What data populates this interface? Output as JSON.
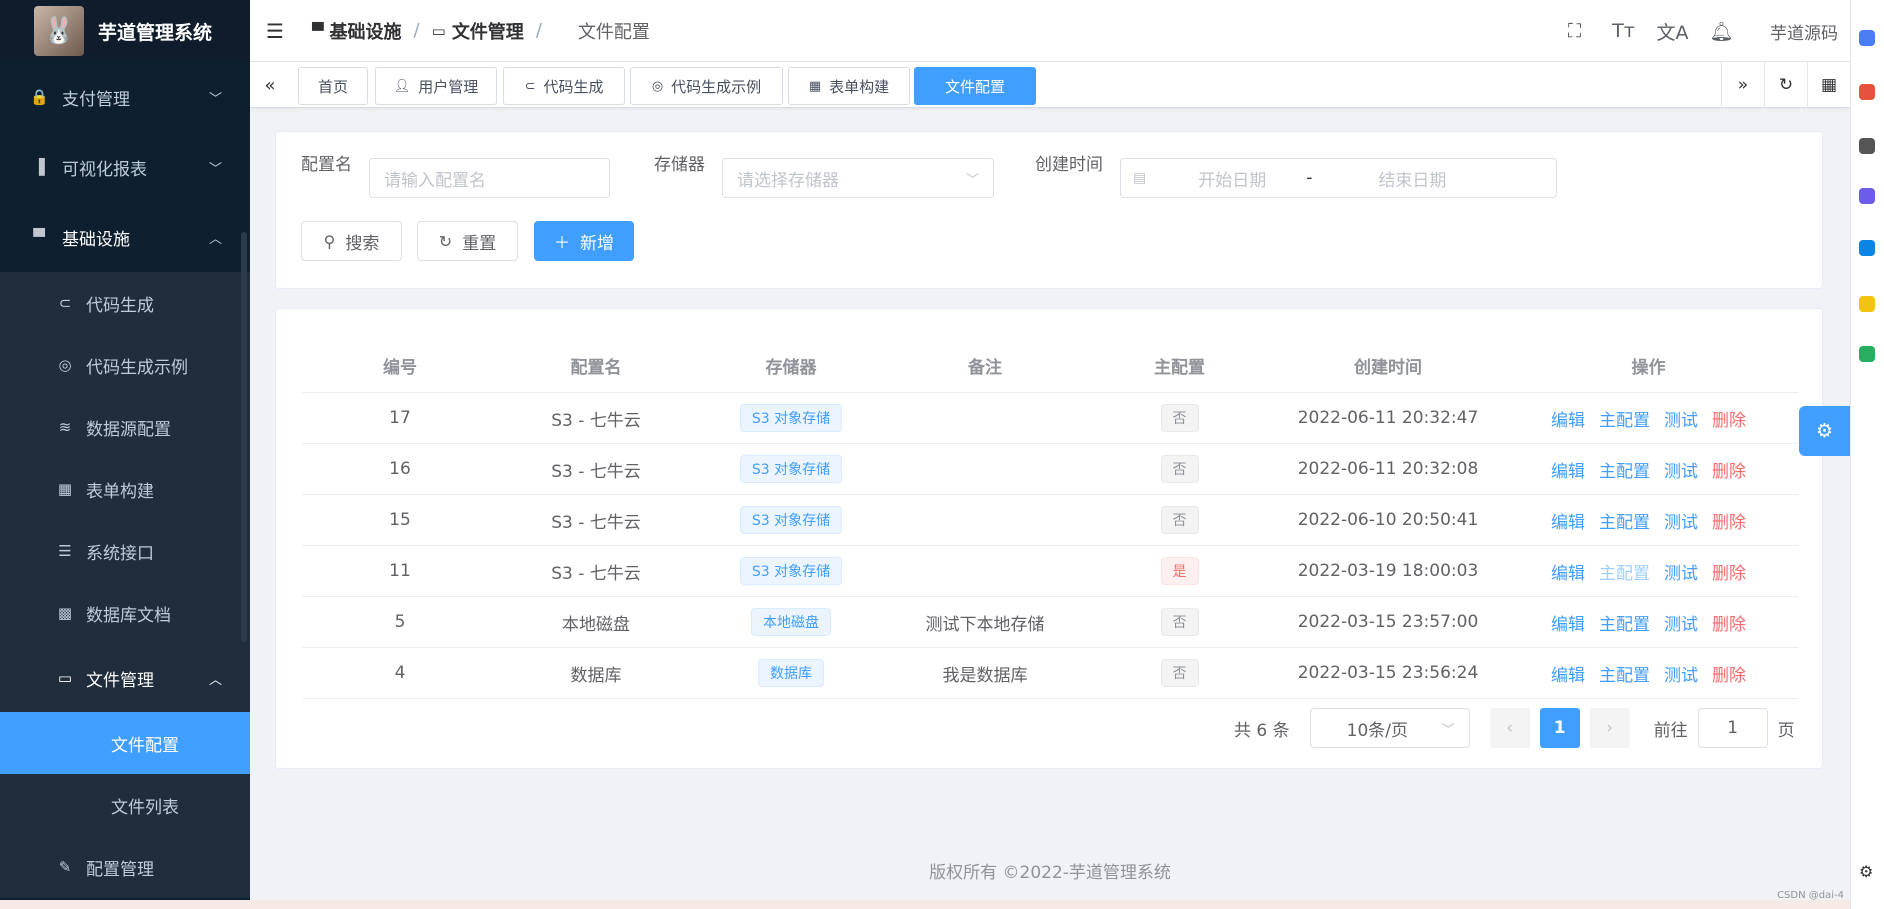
{
  "sidebar": {
    "title": "芋道管理系统",
    "items": [
      {
        "label": "支付管理",
        "icon": "lock-bag-icon"
      },
      {
        "label": "可视化报表",
        "icon": "bar-chart-icon"
      },
      {
        "label": "基础设施",
        "icon": "monitor-icon"
      }
    ],
    "infra_children": [
      {
        "label": "代码生成",
        "icon": "code-icon"
      },
      {
        "label": "代码生成示例",
        "icon": "compass-icon"
      },
      {
        "label": "数据源配置",
        "icon": "database-icon"
      },
      {
        "label": "表单构建",
        "icon": "form-icon"
      },
      {
        "label": "系统接口",
        "icon": "sliders-icon"
      },
      {
        "label": "数据库文档",
        "icon": "table-icon"
      },
      {
        "label": "文件管理",
        "icon": "folder-icon"
      }
    ],
    "file_children": [
      {
        "label": "文件配置"
      },
      {
        "label": "文件列表"
      }
    ],
    "last_item": {
      "label": "配置管理",
      "icon": "edit-icon"
    }
  },
  "navbar": {
    "breadcrumb": [
      "基础设施",
      "文件管理",
      "文件配置"
    ],
    "user": "芋道源码"
  },
  "tags": [
    "首页",
    "用户管理",
    "代码生成",
    "代码生成示例",
    "表单构建",
    "文件配置"
  ],
  "search": {
    "name_label": "配置名",
    "name_placeholder": "请输入配置名",
    "storage_label": "存储器",
    "storage_placeholder": "请选择存储器",
    "time_label": "创建时间",
    "start_placeholder": "开始日期",
    "range_sep": "-",
    "end_placeholder": "结束日期",
    "search_btn": "搜索",
    "reset_btn": "重置",
    "add_btn": "新增"
  },
  "table": {
    "headers": [
      "编号",
      "配置名",
      "存储器",
      "备注",
      "主配置",
      "创建时间",
      "操作"
    ],
    "rows": [
      {
        "id": "17",
        "name": "S3 - 七牛云",
        "storage": "S3 对象存储",
        "remark": "",
        "master": "否",
        "master_yes": false,
        "time": "2022-06-11 20:32:47"
      },
      {
        "id": "16",
        "name": "S3 - 七牛云",
        "storage": "S3 对象存储",
        "remark": "",
        "master": "否",
        "master_yes": false,
        "time": "2022-06-11 20:32:08"
      },
      {
        "id": "15",
        "name": "S3 - 七牛云",
        "storage": "S3 对象存储",
        "remark": "",
        "master": "否",
        "master_yes": false,
        "time": "2022-06-10 20:50:41"
      },
      {
        "id": "11",
        "name": "S3 - 七牛云",
        "storage": "S3 对象存储",
        "remark": "",
        "master": "是",
        "master_yes": true,
        "time": "2022-03-19 18:00:03"
      },
      {
        "id": "5",
        "name": "本地磁盘",
        "storage": "本地磁盘",
        "remark": "测试下本地存储",
        "master": "否",
        "master_yes": false,
        "time": "2022-03-15 23:57:00"
      },
      {
        "id": "4",
        "name": "数据库",
        "storage": "数据库",
        "remark": "我是数据库",
        "master": "否",
        "master_yes": false,
        "time": "2022-03-15 23:56:24"
      }
    ],
    "actions": [
      "编辑",
      "主配置",
      "测试",
      "删除"
    ]
  },
  "pagination": {
    "total": "共 6 条",
    "page_size": "10条/页",
    "current": "1",
    "goto_label": "前往",
    "goto_value": "1",
    "page_suffix": "页"
  },
  "footer": "版权所有 ©2022-芋道管理系统",
  "watermark": "CSDN @dai-4",
  "colors": {
    "primary": "#409eff",
    "sidebar": "#0e1f30",
    "danger": "#f56c6c"
  }
}
